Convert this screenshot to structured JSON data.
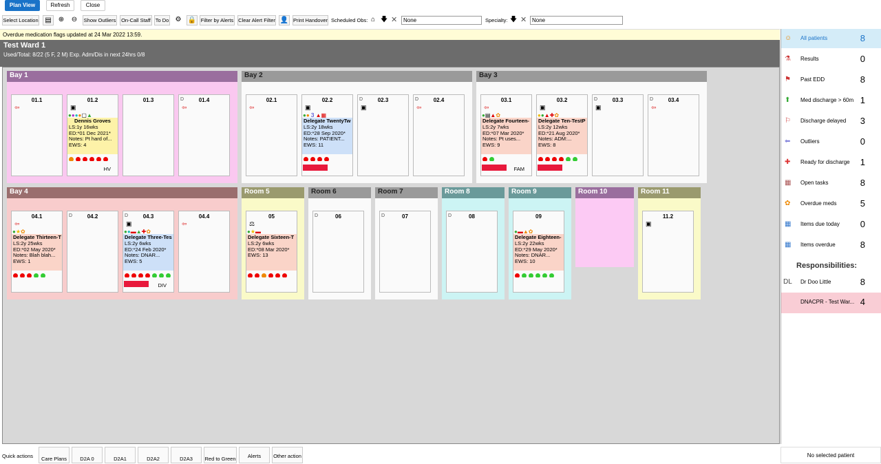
{
  "top": {
    "plan_view": "Plan View",
    "refresh": "Refresh",
    "close": "Close"
  },
  "toolbar": {
    "select_location": "Select Location",
    "show_outliers": "Show Outliers",
    "on_call_staff": "On-Call Staff",
    "to_do": "To Do",
    "filter_by_alerts": "Filter by Alerts",
    "clear_alert_filter": "Clear Alert Filter",
    "print_handover": "Print Handover",
    "scheduled_obs_label": "Scheduled Obs:",
    "scheduled_obs_value": "None",
    "specialty_label": "Specialty:",
    "specialty_value": "None"
  },
  "notice": "Overdue medication flags updated at 24 Mar 2022 13:59.",
  "ward": {
    "title": "Test Ward 1",
    "subtitle": "Used/Total: 8/22 (5 F, 2 M) Exp. Adm/Dis in next 24hrs 0/8"
  },
  "bays": {
    "bay1": "Bay 1",
    "bay2": "Bay 2",
    "bay3": "Bay 3",
    "bay4": "Bay 4",
    "room5": "Room 5",
    "room6": "Room 6",
    "room7": "Room 7",
    "room8": "Room 8",
    "room9": "Room 9",
    "room10": "Room 10",
    "room11": "Room 11"
  },
  "beds": {
    "b011": "01.1",
    "b012": "01.2",
    "b013": "01.3",
    "b014": "01.4",
    "b021": "02.1",
    "b022": "02.2",
    "b023": "02.3",
    "b024": "02.4",
    "b031": "03.1",
    "b032": "03.2",
    "b033": "03.3",
    "b034": "03.4",
    "b041": "04.1",
    "b042": "04.2",
    "b043": "04.3",
    "b044": "04.4",
    "b05": "05",
    "b06": "06",
    "b07": "07",
    "b08": "08",
    "b09": "09",
    "b112": "11.2",
    "d": "D"
  },
  "patients": {
    "p012": {
      "name": "Dennis Groves",
      "ls": "LS:1y 16wks",
      "ed": "ED:*01 Dec 2021*",
      "notes": "Notes: Pt hard of...",
      "ews": "EWS: 4",
      "tag": "HV"
    },
    "p022": {
      "name": "Delegate TwentyTw",
      "ls": "LS:2y 18wks",
      "ed": "ED:*28 Sep 2020*",
      "notes": "Notes: PATIENT...",
      "ews": "EWS: 11",
      "num": "3"
    },
    "p031": {
      "name": "Delegate Fourteen-",
      "ls": "LS:2y 7wks",
      "ed": "ED:*07 Mar 2020*",
      "notes": "Notes: Pt uses...",
      "ews": "EWS: 9",
      "tag": "FAM"
    },
    "p032": {
      "name": "Delegate Ten-TestP",
      "ls": "LS:2y 12wks",
      "ed": "ED:*21 Aug 2020*",
      "notes": "Notes: ADM:...",
      "ews": "EWS: 8"
    },
    "p041": {
      "name": "Delegate Thirteen-T",
      "ls": "LS:2y 25wks",
      "ed": "ED:*02 May 2020*",
      "notes": "Notes: Blah blah...",
      "ews": "EWS: 1"
    },
    "p043": {
      "name": "Delegate Three-Tes",
      "ls": "LS:2y 6wks",
      "ed": "ED:*24 Feb 2020*",
      "notes": "Notes: DNAR...",
      "ews": "EWS: 5",
      "tag": "DIV"
    },
    "p05": {
      "name": "Delegate Sixteen-T",
      "ls": "LS:2y 6wks",
      "ed": "ED:*08 Mar 2020*",
      "ews": "EWS: 13"
    },
    "p09": {
      "name": "Delegate Eighteen-",
      "ls": "LS:2y 22wks",
      "ed": "ED:*29 May 2020*",
      "notes": "Notes: DNAR...",
      "ews": "EWS: 10"
    }
  },
  "side": {
    "items": [
      {
        "label": "All patients",
        "value": "8"
      },
      {
        "label": "Results",
        "value": "0"
      },
      {
        "label": "Past EDD",
        "value": "8"
      },
      {
        "label": "Med discharge > 60m",
        "value": "1"
      },
      {
        "label": "Discharge delayed",
        "value": "3"
      },
      {
        "label": "Outliers",
        "value": "0"
      },
      {
        "label": "Ready for discharge",
        "value": "1"
      },
      {
        "label": "Open tasks",
        "value": "8"
      },
      {
        "label": "Overdue meds",
        "value": "5"
      },
      {
        "label": "Items due today",
        "value": "0"
      },
      {
        "label": "Items overdue",
        "value": "8"
      }
    ],
    "responsibilities": "Responsibilities:",
    "dl_initials": "DL",
    "dl_name": "Dr Doo Little",
    "dl_value": "8",
    "dnacpr": "DNACPR - Test War...",
    "dnacpr_value": "4"
  },
  "bottom": {
    "quick_actions": "Quick actions",
    "care_plans": "Care Plans",
    "d2a0": "D2A 0",
    "d2a1": "D2A1",
    "d2a2": "D2A2",
    "d2a3": "D2A3",
    "red_to_green": "Red to Green",
    "alerts": "Alerts",
    "other_action": "Other action",
    "no_patient": "No selected patient"
  }
}
